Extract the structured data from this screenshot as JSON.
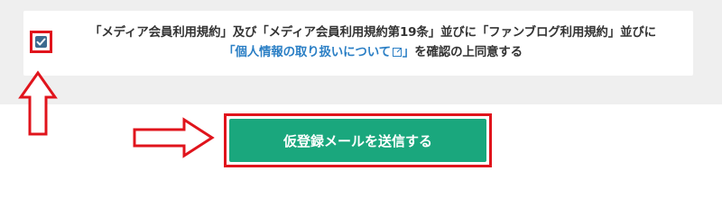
{
  "consent": {
    "checked": true,
    "text_line1": "「メディア会員利用規約」及び「メディア会員利用規約第19条」並びに「ファンブログ利用規約」並びに",
    "link_open": "「",
    "privacy_link": "個人情報の取り扱いについて",
    "link_close": "」",
    "text_line2_tail": "を確認の上同意する",
    "external_icon": "external-link-icon"
  },
  "submit": {
    "label": "仮登録メールを送信する"
  },
  "annotations": {
    "up_arrow": "up-arrow-icon",
    "right_arrow": "right-arrow-icon",
    "highlight_color": "#e0141c"
  },
  "colors": {
    "page_band": "#efefef",
    "card": "#ffffff",
    "checkbox": "#3d6a8f",
    "link": "#2b7fc5",
    "button": "#1aa77d",
    "text": "#333333"
  }
}
